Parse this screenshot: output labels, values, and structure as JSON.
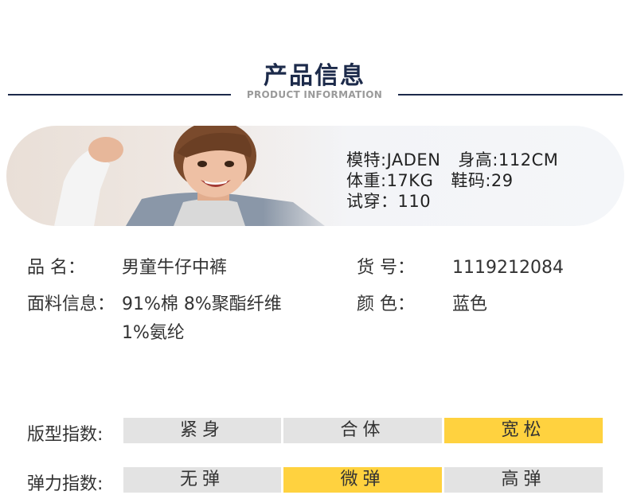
{
  "header": {
    "title": "产品信息",
    "subtitle": "PRODUCT INFORMATION"
  },
  "model": {
    "name_label": "模特:JADEN",
    "height_label": "身高:112CM",
    "weight_label": "体重:17KG",
    "shoe_label": "鞋码:29",
    "trial_label": "试穿：110"
  },
  "specs": {
    "name_key": "品 名：",
    "name_value": "男童牛仔中裤",
    "sku_key": "货 号：",
    "sku_value": "1119212084",
    "fabric_key": "面料信息：",
    "fabric_value_line1": "91%棉 8%聚酯纤维",
    "fabric_value_line2": "1%氨纶",
    "color_key": "颜 色：",
    "color_value": "蓝色"
  },
  "fit_index": {
    "label": "版型指数:",
    "options": [
      "紧身",
      "合体",
      "宽松"
    ],
    "selected": "宽松"
  },
  "stretch_index": {
    "label": "弹力指数:",
    "options": [
      "无弹",
      "微弹",
      "高弹"
    ],
    "selected": "微弹"
  },
  "colors": {
    "accent": "#ffd23f",
    "inactive": "#e3e3e3",
    "heading": "#1c2a4a"
  }
}
